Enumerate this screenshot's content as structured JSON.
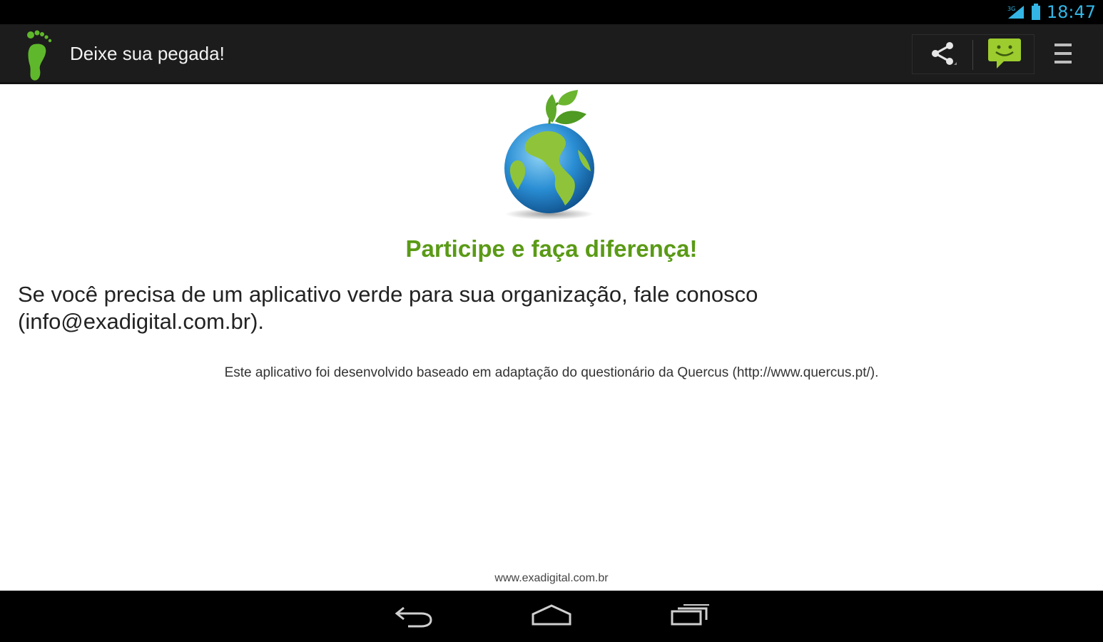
{
  "status_bar": {
    "time": "18:47",
    "icons": [
      "signal-icon",
      "battery-icon"
    ]
  },
  "action_bar": {
    "title": "Deixe sua pegada!",
    "icons": {
      "app": "footprint-icon",
      "share": "share-icon",
      "chat": "chat-smiley-icon",
      "overflow": "overflow-menu-icon"
    }
  },
  "content": {
    "headline": "Participe e faça diferença!",
    "body": "Se você precisa de um aplicativo verde para sua organização, fale conosco (info@exadigital.com.br).",
    "credit": "Este aplicativo foi desenvolvido baseado em adaptação do questionário da Quercus (http://www.quercus.pt/).",
    "footer_link": "www.exadigital.com.br",
    "image": "earth-globe-with-leaf"
  },
  "nav_bar": {
    "icons": [
      "back-icon",
      "home-icon",
      "recents-icon"
    ]
  },
  "colors": {
    "accent_green": "#5a9a16",
    "clock_blue": "#33b5e5",
    "action_bar_bg": "#1c1c1c"
  }
}
